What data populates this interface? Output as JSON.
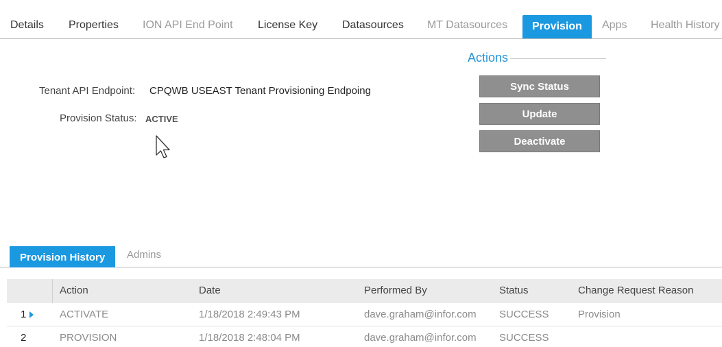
{
  "tabs": [
    {
      "label": "Details",
      "state": "normal"
    },
    {
      "label": "Properties",
      "state": "normal"
    },
    {
      "label": "ION API End Point",
      "state": "disabled"
    },
    {
      "label": "License Key",
      "state": "normal"
    },
    {
      "label": "Datasources",
      "state": "normal"
    },
    {
      "label": "MT Datasources",
      "state": "disabled"
    },
    {
      "label": "Provision",
      "state": "active"
    },
    {
      "label": "Apps",
      "state": "disabled"
    },
    {
      "label": "Health History",
      "state": "disabled"
    }
  ],
  "provision": {
    "endpoint_label": "Tenant API Endpoint:",
    "endpoint_value": "CPQWB USEAST Tenant Provisioning Endpoing",
    "status_label": "Provision Status:",
    "status_value": "ACTIVE"
  },
  "actions": {
    "title": "Actions",
    "sync_status": "Sync Status",
    "update": "Update",
    "deactivate": "Deactivate"
  },
  "sub_tabs": {
    "history": "Provision History",
    "admins": "Admins"
  },
  "grid": {
    "columns": [
      "Action",
      "Date",
      "Performed By",
      "Status",
      "Change Request Reason"
    ],
    "rows": [
      {
        "num": "1",
        "action": "ACTIVATE",
        "date": "1/18/2018 2:49:43 PM",
        "performed_by": "dave.graham@infor.com",
        "status": "SUCCESS",
        "reason": "Provision"
      },
      {
        "num": "2",
        "action": "PROVISION",
        "date": "1/18/2018 2:48:04 PM",
        "performed_by": "dave.graham@infor.com",
        "status": "SUCCESS",
        "reason": ""
      }
    ]
  },
  "colors": {
    "accent": "#1a98e0",
    "button_gray": "#8f8f8f",
    "actions_title": "#2a94d6"
  }
}
